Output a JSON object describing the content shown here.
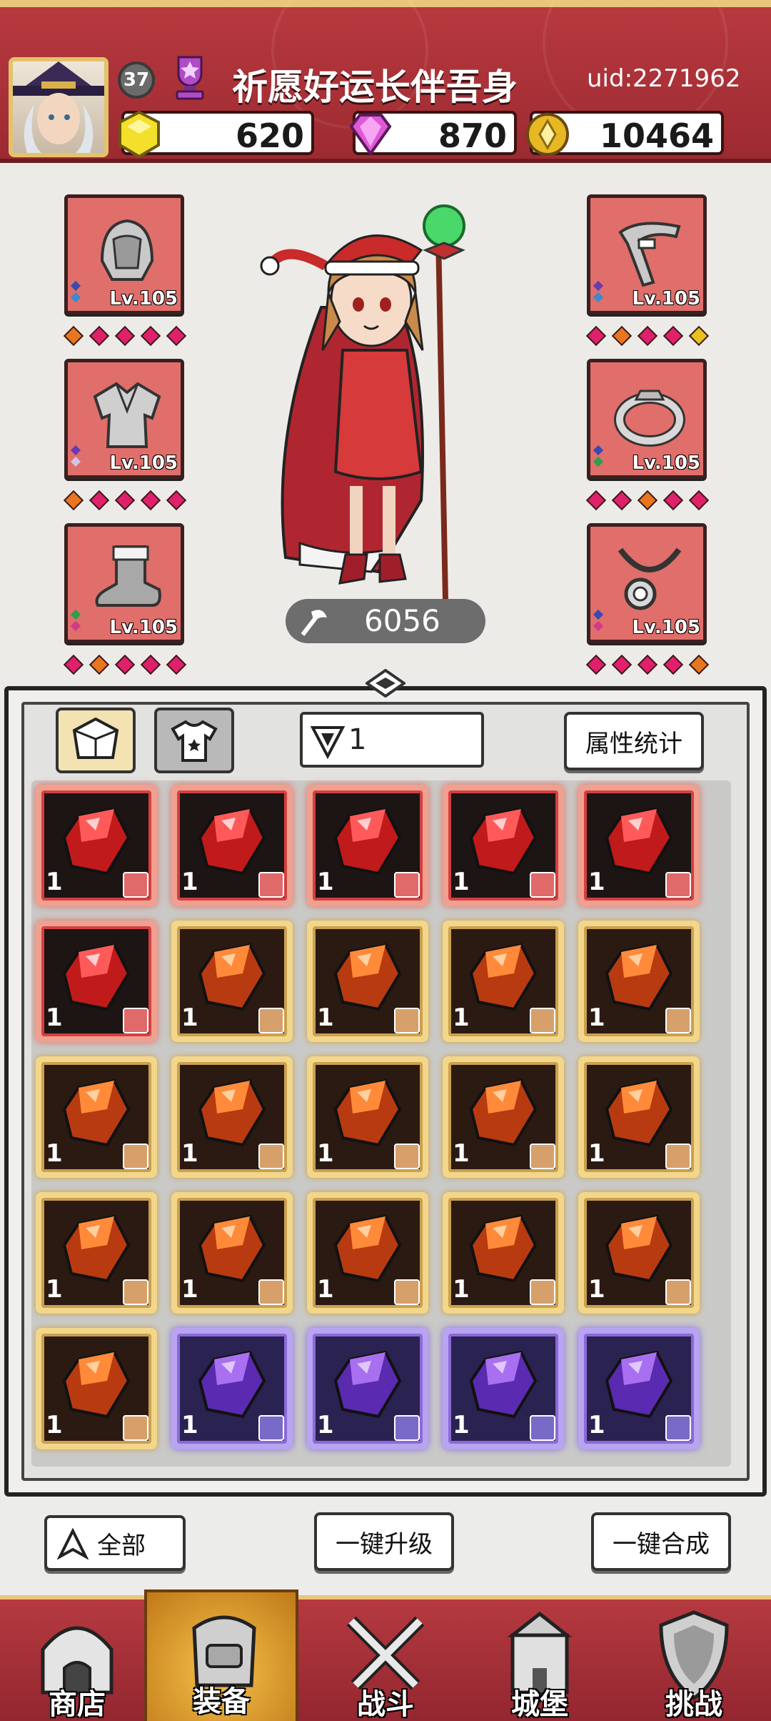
{
  "header": {
    "level": "37",
    "player_name": "祈愿好运长伴吾身",
    "uid": "uid:2271962",
    "currencies": [
      {
        "icon": "yellow-gem-icon",
        "value": "620"
      },
      {
        "icon": "purple-diamond-icon",
        "value": "870"
      },
      {
        "icon": "gold-coin-icon",
        "value": "10464"
      }
    ]
  },
  "equipment": {
    "left": [
      {
        "name": "helmet",
        "level": "Lv.105",
        "quality": [
          "#e8761f",
          "#e0206a",
          "#e0206a",
          "#e0206a",
          "#e0206a"
        ]
      },
      {
        "name": "armor",
        "level": "Lv.105",
        "quality": [
          "#e8761f",
          "#e0206a",
          "#e0206a",
          "#e0206a",
          "#e0206a"
        ]
      },
      {
        "name": "boots",
        "level": "Lv.105",
        "quality": [
          "#e0206a",
          "#e8761f",
          "#e0206a",
          "#e0206a",
          "#e0206a"
        ]
      }
    ],
    "right": [
      {
        "name": "weapon",
        "level": "Lv.105",
        "quality": [
          "#e0206a",
          "#e8761f",
          "#e0206a",
          "#e0206a",
          "#e8c020"
        ]
      },
      {
        "name": "ring",
        "level": "Lv.105",
        "quality": [
          "#e0206a",
          "#e0206a",
          "#e8761f",
          "#e0206a",
          "#e0206a"
        ]
      },
      {
        "name": "necklace",
        "level": "Lv.105",
        "quality": [
          "#e0206a",
          "#e0206a",
          "#e0206a",
          "#e0206a",
          "#e8761f"
        ]
      }
    ],
    "power": "6056"
  },
  "bag": {
    "filter_value": "1",
    "stats_button": "属性统计",
    "items": [
      {
        "rarity": "red",
        "count": "1"
      },
      {
        "rarity": "red",
        "count": "1"
      },
      {
        "rarity": "red",
        "count": "1"
      },
      {
        "rarity": "red",
        "count": "1"
      },
      {
        "rarity": "red",
        "count": "1"
      },
      {
        "rarity": "red",
        "count": "1"
      },
      {
        "rarity": "orange",
        "count": "1"
      },
      {
        "rarity": "orange",
        "count": "1"
      },
      {
        "rarity": "orange",
        "count": "1"
      },
      {
        "rarity": "orange",
        "count": "1"
      },
      {
        "rarity": "orange",
        "count": "1"
      },
      {
        "rarity": "orange",
        "count": "1"
      },
      {
        "rarity": "orange",
        "count": "1"
      },
      {
        "rarity": "orange",
        "count": "1"
      },
      {
        "rarity": "orange",
        "count": "1"
      },
      {
        "rarity": "orange",
        "count": "1"
      },
      {
        "rarity": "orange",
        "count": "1"
      },
      {
        "rarity": "orange",
        "count": "1"
      },
      {
        "rarity": "orange",
        "count": "1"
      },
      {
        "rarity": "orange",
        "count": "1"
      },
      {
        "rarity": "orange",
        "count": "1"
      },
      {
        "rarity": "purple",
        "count": "1"
      },
      {
        "rarity": "purple",
        "count": "1"
      },
      {
        "rarity": "purple",
        "count": "1"
      },
      {
        "rarity": "purple",
        "count": "1"
      }
    ]
  },
  "actions": {
    "all_label": "全部",
    "upgrade_label": "一键升级",
    "merge_label": "一键合成"
  },
  "nav": [
    {
      "label": "商店",
      "active": false
    },
    {
      "label": "装备",
      "active": true
    },
    {
      "label": "战斗",
      "active": false
    },
    {
      "label": "城堡",
      "active": false
    },
    {
      "label": "挑战",
      "active": false
    }
  ]
}
